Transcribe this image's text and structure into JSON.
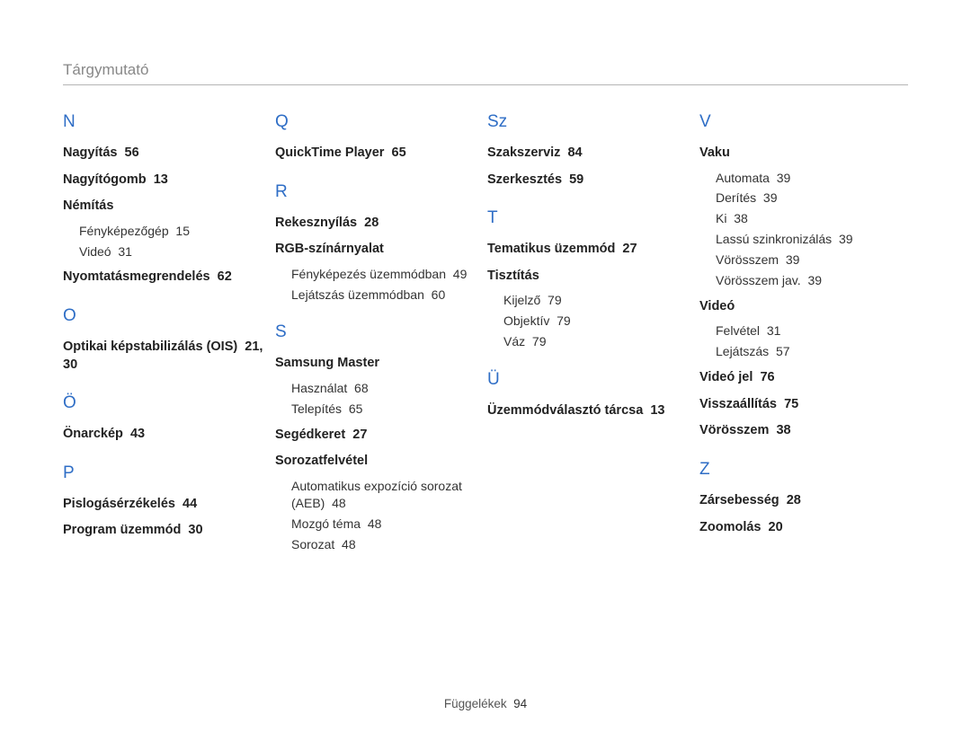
{
  "header": "Tárgymutató",
  "footer": {
    "label": "Függelékek",
    "page": "94"
  },
  "columns": [
    {
      "sections": [
        {
          "letter": "N",
          "entries": [
            {
              "label": "Nagyítás",
              "page": "56"
            },
            {
              "label": "Nagyítógomb",
              "page": "13"
            },
            {
              "label": "Némítás",
              "subs": [
                {
                  "label": "Fényképezőgép",
                  "page": "15"
                },
                {
                  "label": "Videó",
                  "page": "31"
                }
              ]
            },
            {
              "label": "Nyomtatásmegrendelés",
              "page": "62"
            }
          ]
        },
        {
          "letter": "O",
          "entries": [
            {
              "label": "Optikai képstabilizálás (OIS)",
              "page": "21, 30"
            }
          ]
        },
        {
          "letter": "Ö",
          "entries": [
            {
              "label": "Önarckép",
              "page": "43"
            }
          ]
        },
        {
          "letter": "P",
          "entries": [
            {
              "label": "Pislogásérzékelés",
              "page": "44"
            },
            {
              "label": "Program üzemmód",
              "page": "30"
            }
          ]
        }
      ]
    },
    {
      "sections": [
        {
          "letter": "Q",
          "entries": [
            {
              "label": "QuickTime Player",
              "page": "65"
            }
          ]
        },
        {
          "letter": "R",
          "entries": [
            {
              "label": "Rekesznyílás",
              "page": "28"
            },
            {
              "label": "RGB-színárnyalat",
              "subs": [
                {
                  "label": "Fényképezés üzemmódban",
                  "page": "49"
                },
                {
                  "label": "Lejátszás üzemmódban",
                  "page": "60"
                }
              ]
            }
          ]
        },
        {
          "letter": "S",
          "entries": [
            {
              "label": "Samsung Master",
              "subs": [
                {
                  "label": "Használat",
                  "page": "68"
                },
                {
                  "label": "Telepítés",
                  "page": "65"
                }
              ]
            },
            {
              "label": "Segédkeret",
              "page": "27"
            },
            {
              "label": "Sorozatfelvétel",
              "subs": [
                {
                  "label": "Automatikus expozíció sorozat (AEB)",
                  "page": "48"
                },
                {
                  "label": "Mozgó téma",
                  "page": "48"
                },
                {
                  "label": "Sorozat",
                  "page": "48"
                }
              ]
            }
          ]
        }
      ]
    },
    {
      "sections": [
        {
          "letter": "Sz",
          "entries": [
            {
              "label": "Szakszerviz",
              "page": "84"
            },
            {
              "label": "Szerkesztés",
              "page": "59"
            }
          ]
        },
        {
          "letter": "T",
          "entries": [
            {
              "label": "Tematikus üzemmód",
              "page": "27"
            },
            {
              "label": "Tisztítás",
              "subs": [
                {
                  "label": "Kijelző",
                  "page": "79"
                },
                {
                  "label": "Objektív",
                  "page": "79"
                },
                {
                  "label": "Váz",
                  "page": "79"
                }
              ]
            }
          ]
        },
        {
          "letter": "Ü",
          "entries": [
            {
              "label": "Üzemmódválasztó tárcsa",
              "page": "13"
            }
          ]
        }
      ]
    },
    {
      "sections": [
        {
          "letter": "V",
          "entries": [
            {
              "label": "Vaku",
              "subs": [
                {
                  "label": "Automata",
                  "page": "39"
                },
                {
                  "label": "Derítés",
                  "page": "39"
                },
                {
                  "label": "Ki",
                  "page": "38"
                },
                {
                  "label": "Lassú szinkronizálás",
                  "page": "39"
                },
                {
                  "label": "Vörösszem",
                  "page": "39"
                },
                {
                  "label": "Vörösszem jav.",
                  "page": "39"
                }
              ]
            },
            {
              "label": "Videó",
              "subs": [
                {
                  "label": "Felvétel",
                  "page": "31"
                },
                {
                  "label": "Lejátszás",
                  "page": "57"
                }
              ]
            },
            {
              "label": "Videó jel",
              "page": "76"
            },
            {
              "label": "Visszaállítás",
              "page": "75"
            },
            {
              "label": "Vörösszem",
              "page": "38"
            }
          ]
        },
        {
          "letter": "Z",
          "entries": [
            {
              "label": "Zársebesség",
              "page": "28"
            },
            {
              "label": "Zoomolás",
              "page": "20"
            }
          ]
        }
      ]
    }
  ]
}
